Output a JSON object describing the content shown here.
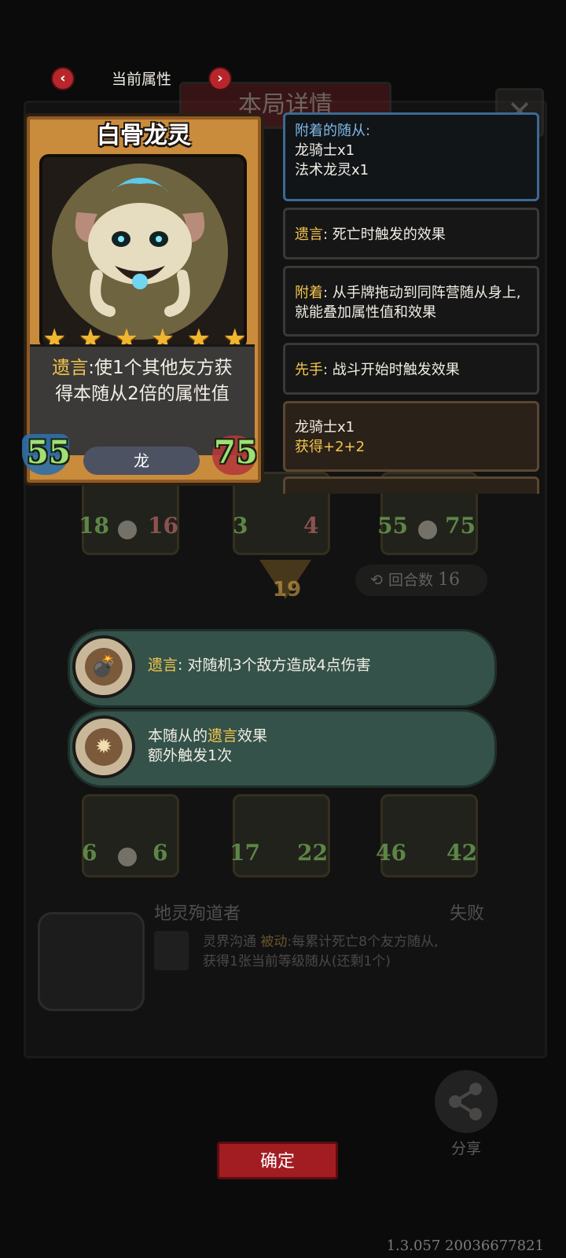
{
  "nav": {
    "title": "当前属性",
    "prev_icon": "‹",
    "next_icon": "›"
  },
  "background": {
    "panel_title": "本局详情",
    "close_icon": "✕",
    "row1": [
      {
        "atk": "18",
        "hp": "16"
      },
      {
        "atk": "3",
        "hp": "4"
      },
      {
        "atk": "55",
        "hp": "75"
      }
    ],
    "round_badge": "19",
    "round_label": "回合数",
    "round_value": "16",
    "row2": [
      {
        "atk": "6",
        "hp": "6"
      },
      {
        "atk": "17",
        "hp": "22"
      },
      {
        "atk": "46",
        "hp": "42"
      }
    ],
    "opponent_name": "地灵殉道者",
    "result": "失败",
    "hero_power_name": "灵界沟通",
    "hero_power_type": "被动",
    "hero_power_desc_1": ":每累计死亡8个友方随从,",
    "hero_power_desc_2": "获得1张当前等级随从(还剩1个)"
  },
  "card": {
    "name": "白骨龙灵",
    "stars": 6,
    "star_glyph": "★",
    "desc_keyword": "遗言",
    "desc_rest": ":使1个其他友方获得本随从2倍的属性值",
    "attack": "55",
    "health": "75",
    "tribe": "龙"
  },
  "info_panels": {
    "attached": {
      "title": "附着的随从:",
      "items": [
        "龙骑士x1",
        "法术龙灵x1"
      ]
    },
    "deathrattle": {
      "keyword": "遗言",
      "text": ": 死亡时触发的效果"
    },
    "attach": {
      "keyword": "附着",
      "text": ": 从手牌拖动到同阵营随从身上,就能叠加属性值和效果"
    },
    "first_strike": {
      "keyword": "先手",
      "text": ": 战斗开始时触发效果"
    },
    "dragon_rider": {
      "name": "龙骑士x1",
      "effect": "获得+2+2"
    }
  },
  "ribbons": [
    {
      "keyword": "遗言",
      "text": ": 对随机3个敌方造成4点伤害",
      "icon": "bomb-icon"
    },
    {
      "prefix": "本随从的",
      "keyword": "遗言",
      "suffix": "效果",
      "line2": "额外触发1次",
      "icon": "sun-rune-icon"
    }
  ],
  "footer": {
    "share_label": "分享",
    "confirm_label": "确定",
    "version": "1.3.057 20036677821"
  },
  "colors": {
    "keyword_gold": "#f4c64d",
    "keyword_blue": "#7fb7e6",
    "confirm_red": "#a11d22",
    "ribbon_teal": "#34524a"
  }
}
